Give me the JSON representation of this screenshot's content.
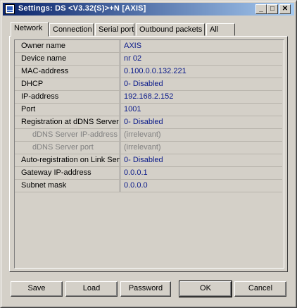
{
  "window": {
    "title": "Settings: DS <V3.32(S)>+N [AXIS]"
  },
  "title_buttons": {
    "minimize": "_",
    "maximize": "□",
    "close": "✕"
  },
  "tabs": [
    {
      "label": "Network",
      "active": true
    },
    {
      "label": "Connection",
      "active": false
    },
    {
      "label": "Serial port",
      "active": false
    },
    {
      "label": "Outbound packets",
      "active": false
    },
    {
      "label": "All",
      "active": false
    }
  ],
  "properties": [
    {
      "key": "Owner name",
      "value": "AXIS"
    },
    {
      "key": "Device name",
      "value": "nr 02"
    },
    {
      "key": "MAC-address",
      "value": "0.100.0.0.132.221"
    },
    {
      "key": "DHCP",
      "value": "0- Disabled"
    },
    {
      "key": "IP-address",
      "value": "192.168.2.152"
    },
    {
      "key": "Port",
      "value": "1001"
    },
    {
      "key": "Registration at dDNS Server",
      "value": "0- Disabled"
    },
    {
      "key": "dDNS Server IP-address",
      "value": "(irrelevant)"
    },
    {
      "key": "dDNS Server port",
      "value": "(irrelevant)"
    },
    {
      "key": "Auto-registration on Link Server",
      "value": "0- Disabled"
    },
    {
      "key": "Gateway IP-address",
      "value": "0.0.0.1"
    },
    {
      "key": "Subnet mask",
      "value": "0.0.0.0"
    }
  ],
  "buttons": {
    "save": "Save",
    "load": "Load",
    "password": "Password",
    "ok": "OK",
    "cancel": "Cancel"
  }
}
